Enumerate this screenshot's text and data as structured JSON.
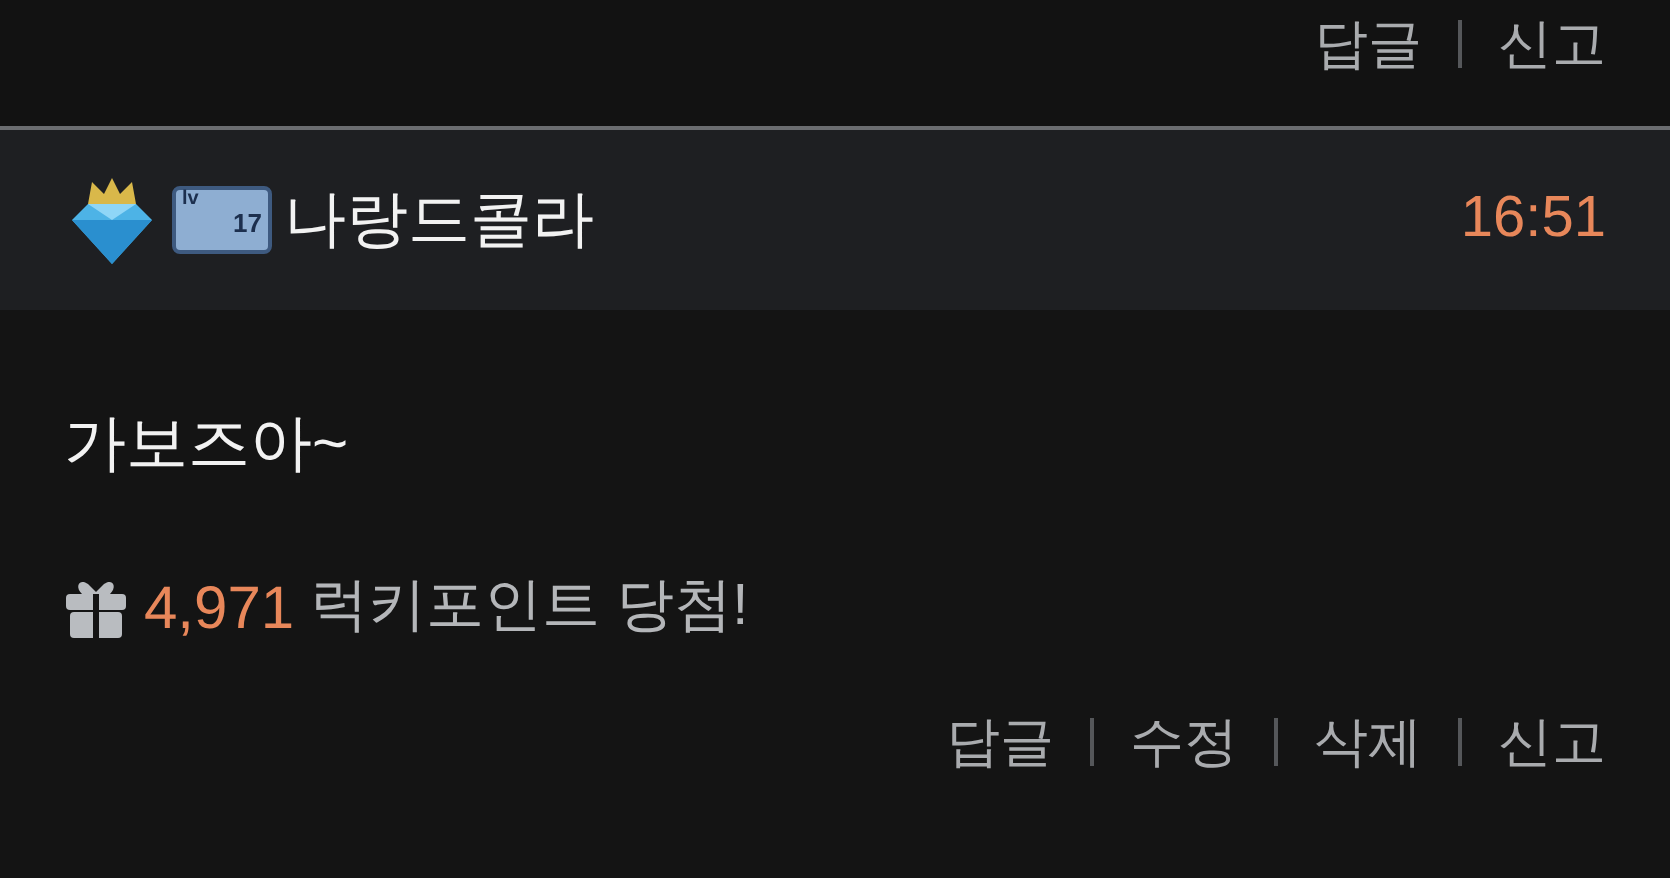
{
  "previous_actions": [
    "답글",
    "신고"
  ],
  "comment": {
    "author": "나랑드콜라",
    "level_badge": {
      "prefix": "lv",
      "level": "17"
    },
    "time": "16:51",
    "text": "가보즈아~",
    "reward": {
      "amount": "4,971",
      "label": "럭키포인트 당첨!"
    },
    "actions": [
      "답글",
      "수정",
      "삭제",
      "신고"
    ]
  }
}
